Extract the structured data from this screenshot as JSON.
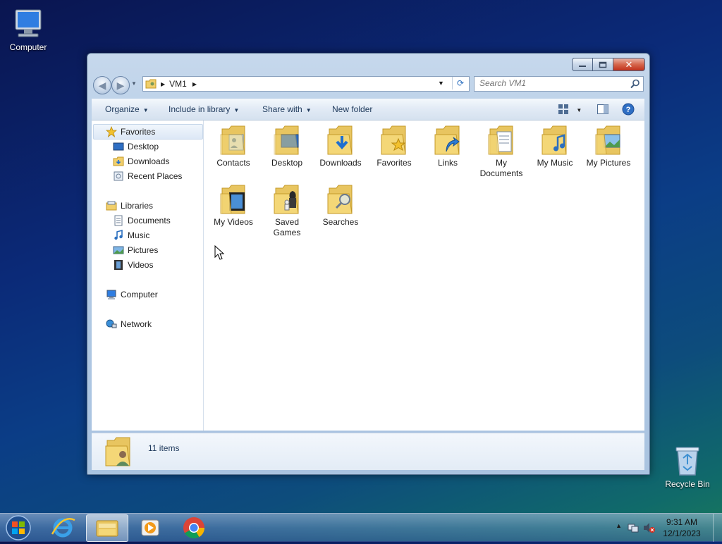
{
  "desktop": {
    "icons": [
      {
        "label": "Computer"
      },
      {
        "label": "Recycle Bin"
      }
    ]
  },
  "window": {
    "address": {
      "crumb": "VM1",
      "search_placeholder": "Search VM1"
    },
    "toolbar": {
      "organize": "Organize",
      "include": "Include in library",
      "share": "Share with",
      "new_folder": "New folder"
    },
    "nav": {
      "favorites": "Favorites",
      "desktop": "Desktop",
      "downloads": "Downloads",
      "recent": "Recent Places",
      "libraries": "Libraries",
      "documents": "Documents",
      "music": "Music",
      "pictures": "Pictures",
      "videos": "Videos",
      "computer": "Computer",
      "network": "Network"
    },
    "items": [
      {
        "label": "Contacts"
      },
      {
        "label": "Desktop"
      },
      {
        "label": "Downloads"
      },
      {
        "label": "Favorites"
      },
      {
        "label": "Links"
      },
      {
        "label": "My Documents"
      },
      {
        "label": "My Music"
      },
      {
        "label": "My Pictures"
      },
      {
        "label": "My Videos"
      },
      {
        "label": "Saved Games"
      },
      {
        "label": "Searches"
      }
    ],
    "status": "11 items"
  },
  "taskbar": {
    "time": "9:31 AM",
    "date": "12/1/2023"
  },
  "colors": {
    "folder": "#f1cf6b",
    "accent": "#1e395b"
  }
}
